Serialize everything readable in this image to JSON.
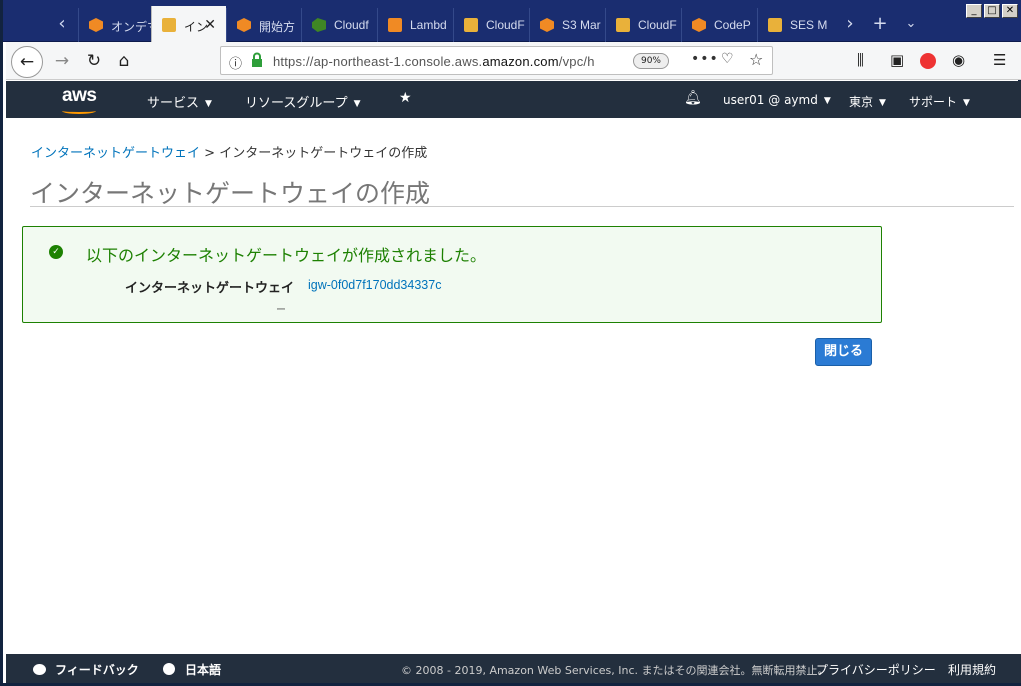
{
  "browser": {
    "tabs": [
      {
        "title": "オンデマ",
        "icon": "aws-cube-icon",
        "active": false
      },
      {
        "title": "イン",
        "icon": "aws-cube-icon",
        "active": true
      },
      {
        "title": "開始方",
        "icon": "aws-hex-icon",
        "active": false
      },
      {
        "title": "Cloudf",
        "icon": "cloudwatch-icon",
        "active": false
      },
      {
        "title": "Lambd",
        "icon": "lambda-icon",
        "active": false
      },
      {
        "title": "CloudF",
        "icon": "aws-cube-icon",
        "active": false
      },
      {
        "title": "S3 Mar",
        "icon": "aws-hex-icon",
        "active": false
      },
      {
        "title": "CloudF",
        "icon": "aws-cube-icon",
        "active": false
      },
      {
        "title": "CodeP",
        "icon": "aws-hex-icon",
        "active": false
      },
      {
        "title": "SES M",
        "icon": "aws-cube-icon",
        "active": false
      }
    ],
    "url": {
      "prefix": "https://ap-northeast-1.console.aws.",
      "domain": "amazon.com",
      "suffix": "/vpc/h"
    },
    "zoom": "90%"
  },
  "aws_header": {
    "logo": "aws",
    "services": "サービス",
    "resource_groups": "リソースグループ",
    "account": "user01 @ aymd",
    "region": "東京",
    "support": "サポート"
  },
  "breadcrumb": {
    "link": "インターネットゲートウェイ",
    "separator": ">",
    "current": "インターネットゲートウェイの作成"
  },
  "page_title": "インターネットゲートウェイの作成",
  "success": {
    "message": "以下のインターネットゲートウェイが作成されました。",
    "label": "インターネットゲートウェイ",
    "gateway_id": "igw-0f0d7f170dd34337c",
    "tiny_mark": "ー"
  },
  "close_button": "閉じる",
  "footer": {
    "feedback": "フィードバック",
    "language": "日本語",
    "copyright": "© 2008 - 2019, Amazon Web Services, Inc. またはその関連会社。無断転用禁止。",
    "privacy": "プライバシーポリシー",
    "terms": "利用規約"
  },
  "colors": {
    "tab_strip": "#1a2d70",
    "aws_nav": "#232f3e",
    "aws_orange": "#ff9900",
    "success_green": "#1d8102",
    "link_blue": "#0073bb",
    "primary_button": "#2b7bd4"
  }
}
